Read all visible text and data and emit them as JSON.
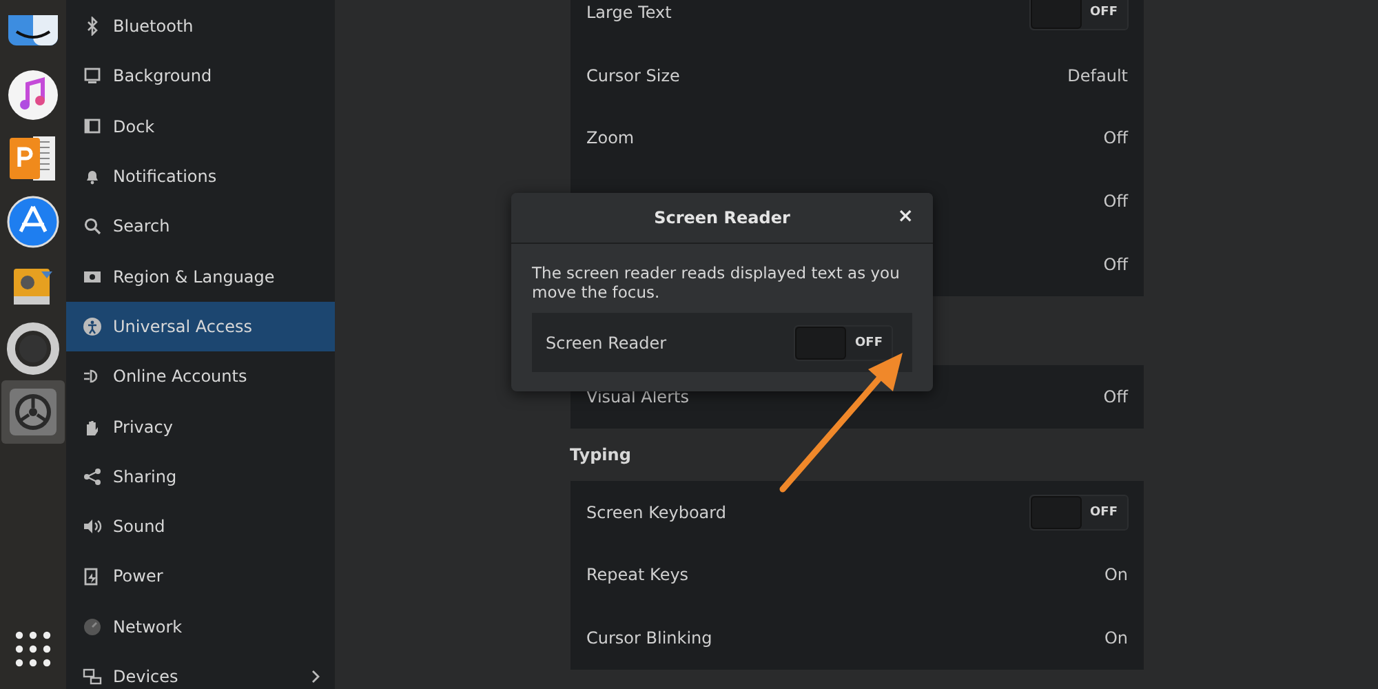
{
  "dock": [
    {
      "kind": "finder",
      "selected": false
    },
    {
      "kind": "music",
      "selected": false
    },
    {
      "kind": "slides",
      "selected": false
    },
    {
      "kind": "store",
      "selected": false
    },
    {
      "kind": "drive",
      "selected": false
    },
    {
      "kind": "help",
      "selected": false
    },
    {
      "kind": "settings",
      "selected": true
    },
    {
      "kind": "apps",
      "selected": false
    }
  ],
  "sidebar": {
    "items": [
      {
        "label": "Bluetooth",
        "kind": "bluetooth",
        "selected": false,
        "chevron": false
      },
      {
        "label": "Background",
        "kind": "background",
        "selected": false,
        "chevron": false
      },
      {
        "label": "Dock",
        "kind": "dock",
        "selected": false,
        "chevron": false
      },
      {
        "label": "Notifications",
        "kind": "bell",
        "selected": false,
        "chevron": false
      },
      {
        "label": "Search",
        "kind": "search",
        "selected": false,
        "chevron": false
      },
      {
        "label": "Region & Language",
        "kind": "region",
        "selected": false,
        "chevron": false
      },
      {
        "label": "Universal Access",
        "kind": "access",
        "selected": true,
        "chevron": false
      },
      {
        "label": "Online Accounts",
        "kind": "accounts",
        "selected": false,
        "chevron": false
      },
      {
        "label": "Privacy",
        "kind": "hand",
        "selected": false,
        "chevron": false
      },
      {
        "label": "Sharing",
        "kind": "share",
        "selected": false,
        "chevron": false
      },
      {
        "label": "Sound",
        "kind": "sound",
        "selected": false,
        "chevron": false
      },
      {
        "label": "Power",
        "kind": "power",
        "selected": false,
        "chevron": false
      },
      {
        "label": "Network",
        "kind": "network",
        "selected": false,
        "chevron": false
      },
      {
        "label": "Devices",
        "kind": "devices",
        "selected": false,
        "chevron": true
      }
    ]
  },
  "sections": [
    {
      "rows": [
        {
          "label": "Large Text",
          "kind": "switch",
          "on": false,
          "value": "OFF"
        },
        {
          "label": "Cursor Size",
          "kind": "value",
          "value": "Default"
        },
        {
          "label": "Zoom",
          "kind": "value",
          "value": "Off"
        },
        {
          "kind": "value",
          "value": "Off"
        },
        {
          "kind": "value",
          "value": "Off"
        }
      ]
    },
    {
      "rows": [
        {
          "label": "Visual Alerts",
          "kind": "value",
          "value": "Off"
        }
      ]
    },
    {
      "heading": "Typing",
      "rows": [
        {
          "label": "Screen Keyboard",
          "kind": "switch",
          "on": false,
          "value": "OFF"
        },
        {
          "label": "Repeat Keys",
          "kind": "value",
          "value": "On"
        },
        {
          "label": "Cursor Blinking",
          "kind": "value",
          "value": "On"
        }
      ]
    }
  ],
  "dialog": {
    "title": "Screen Reader",
    "close": "×",
    "description": "The screen reader reads displayed text as you move the focus.",
    "row": {
      "label": "Screen Reader",
      "on": false,
      "value": "OFF"
    }
  }
}
